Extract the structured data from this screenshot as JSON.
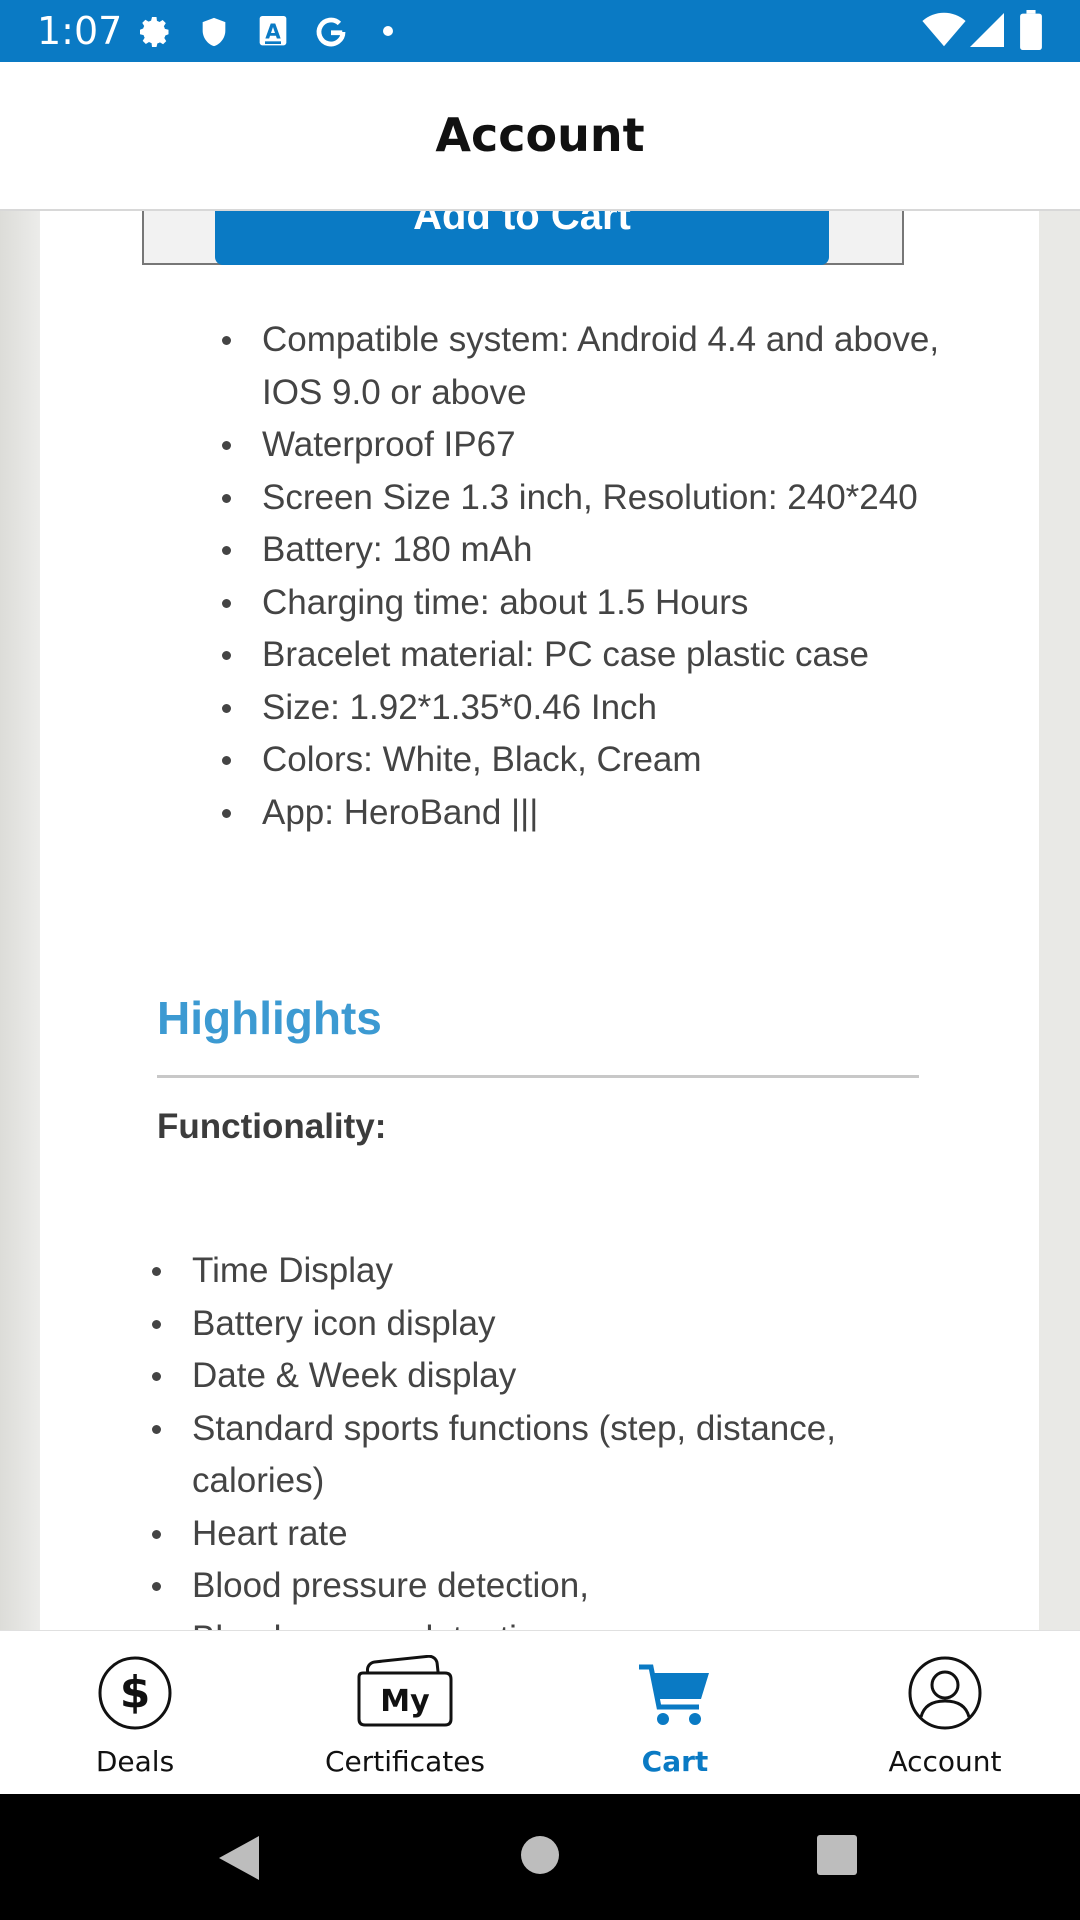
{
  "status_bar": {
    "time": "1:07",
    "left_icons": [
      "gear-icon",
      "shield-icon",
      "translate-a-icon",
      "google-g-icon",
      "dot-icon"
    ],
    "right_icons": [
      "wifi-icon",
      "signal-icon",
      "battery-icon"
    ],
    "color": "#0a7ac4"
  },
  "header": {
    "title": "Account"
  },
  "product": {
    "add_to_cart_label": "Add to Cart",
    "specs": [
      "Compatible system: Android 4.4 and above, IOS 9.0 or above",
      "Waterproof IP67",
      "Screen Size 1.3 inch, Resolution: 240*240",
      "Battery: 180 mAh",
      "Charging time: about 1.5 Hours",
      "Bracelet material: PC case plastic case",
      "Size: 1.92*1.35*0.46 Inch",
      "Colors: White, Black, Cream",
      "App: HeroBand |||"
    ],
    "highlights_heading": "Highlights",
    "functionality_label": "Functionality:",
    "functions": [
      "Time Display",
      "Battery icon display",
      "Date & Week display",
      "Standard sports functions (step, distance, calories)",
      "Heart rate",
      "Blood pressure detection,",
      "Blood oxygen detection"
    ],
    "accent_color": "#3c9ad2"
  },
  "bottom_nav": {
    "items": [
      {
        "label": "Deals",
        "icon": "dollar-circle-icon",
        "active": false
      },
      {
        "label": "Certificates",
        "icon": "my-certificates-icon",
        "active": false
      },
      {
        "label": "Cart",
        "icon": "cart-icon",
        "active": true
      },
      {
        "label": "Account",
        "icon": "user-circle-icon",
        "active": false
      }
    ],
    "active_color": "#0a7ac4"
  },
  "system_nav": {
    "buttons": [
      "back-icon",
      "home-icon",
      "recents-icon"
    ]
  }
}
